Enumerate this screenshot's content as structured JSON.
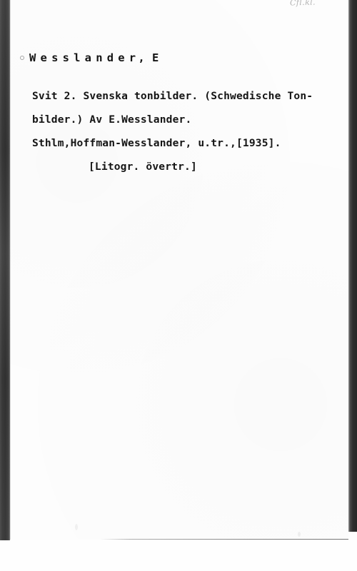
{
  "scan": {
    "card_kind": "library-catalog-card",
    "top_annotation": "Cfl.kl.",
    "edge_shadow_color": "#333333",
    "paper_color": "#fdfdfd",
    "ink_color": "#151515"
  },
  "card": {
    "heading": {
      "leading_mark": "°",
      "surname": "Wesslander",
      "forename_initial": "E",
      "separator": ","
    },
    "lines": {
      "title": "Svit 2. Svenska tonbilder. (Schwedische Ton-",
      "title_continued": "bilder.) Av E.Wesslander.",
      "imprint": "Sthlm,Hoffman-Wesslander, u.tr.,[1935].",
      "note": "[Litogr. övertr.]"
    }
  }
}
